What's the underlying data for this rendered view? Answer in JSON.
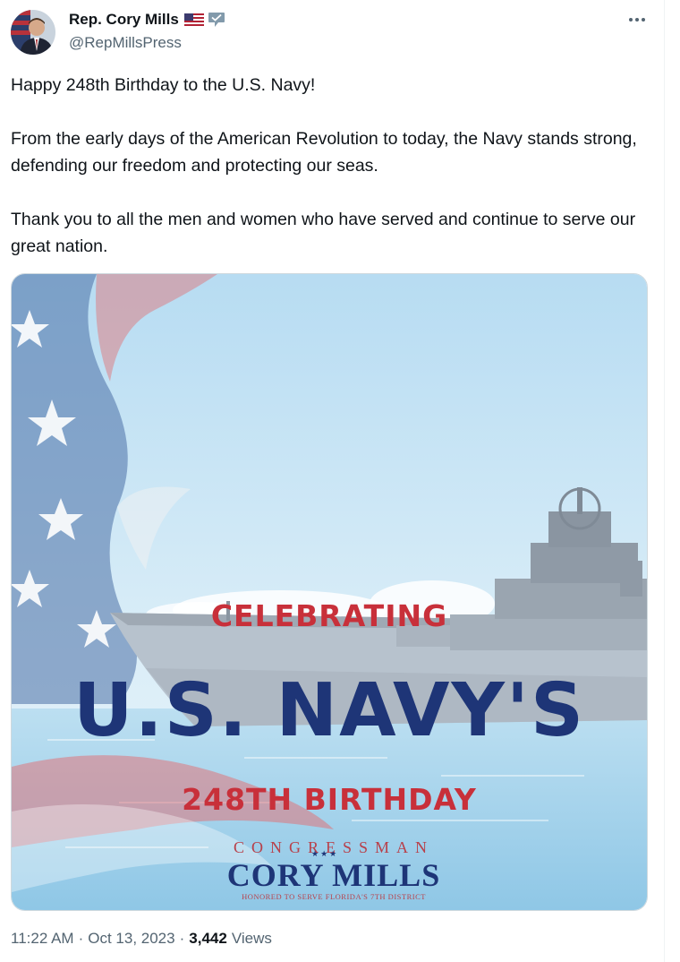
{
  "author": {
    "display_name": "Rep. Cory Mills",
    "handle": "@RepMillsPress"
  },
  "icons": {
    "more": "more-options-icon",
    "flag": "us-flag-icon",
    "badge": "government-badge-icon"
  },
  "tweet": {
    "paragraphs": [
      "Happy 248th Birthday to the U.S. Navy!",
      "From the early days of the American Revolution to today, the Navy stands strong, defending our freedom and protecting our seas.",
      "Thank you to all the men and women who have served and continue to serve our great nation."
    ]
  },
  "media": {
    "line1": "CELEBRATING",
    "line2": "U.S. NAVY'S",
    "line3": "248TH BIRTHDAY",
    "logo_congressman": "CONGRESSMAN",
    "logo_stars": "★★★",
    "logo_name": "CORY MILLS",
    "logo_tagline": "HONORED TO SERVE FLORIDA'S 7TH DISTRICT"
  },
  "meta": {
    "time": "11:22 AM",
    "date": "Oct 13, 2023",
    "views_count": "3,442",
    "views_label": "Views"
  },
  "colors": {
    "text": "#0f1419",
    "secondary": "#536471",
    "navy": "#1e3577",
    "red": "#c8303a"
  }
}
